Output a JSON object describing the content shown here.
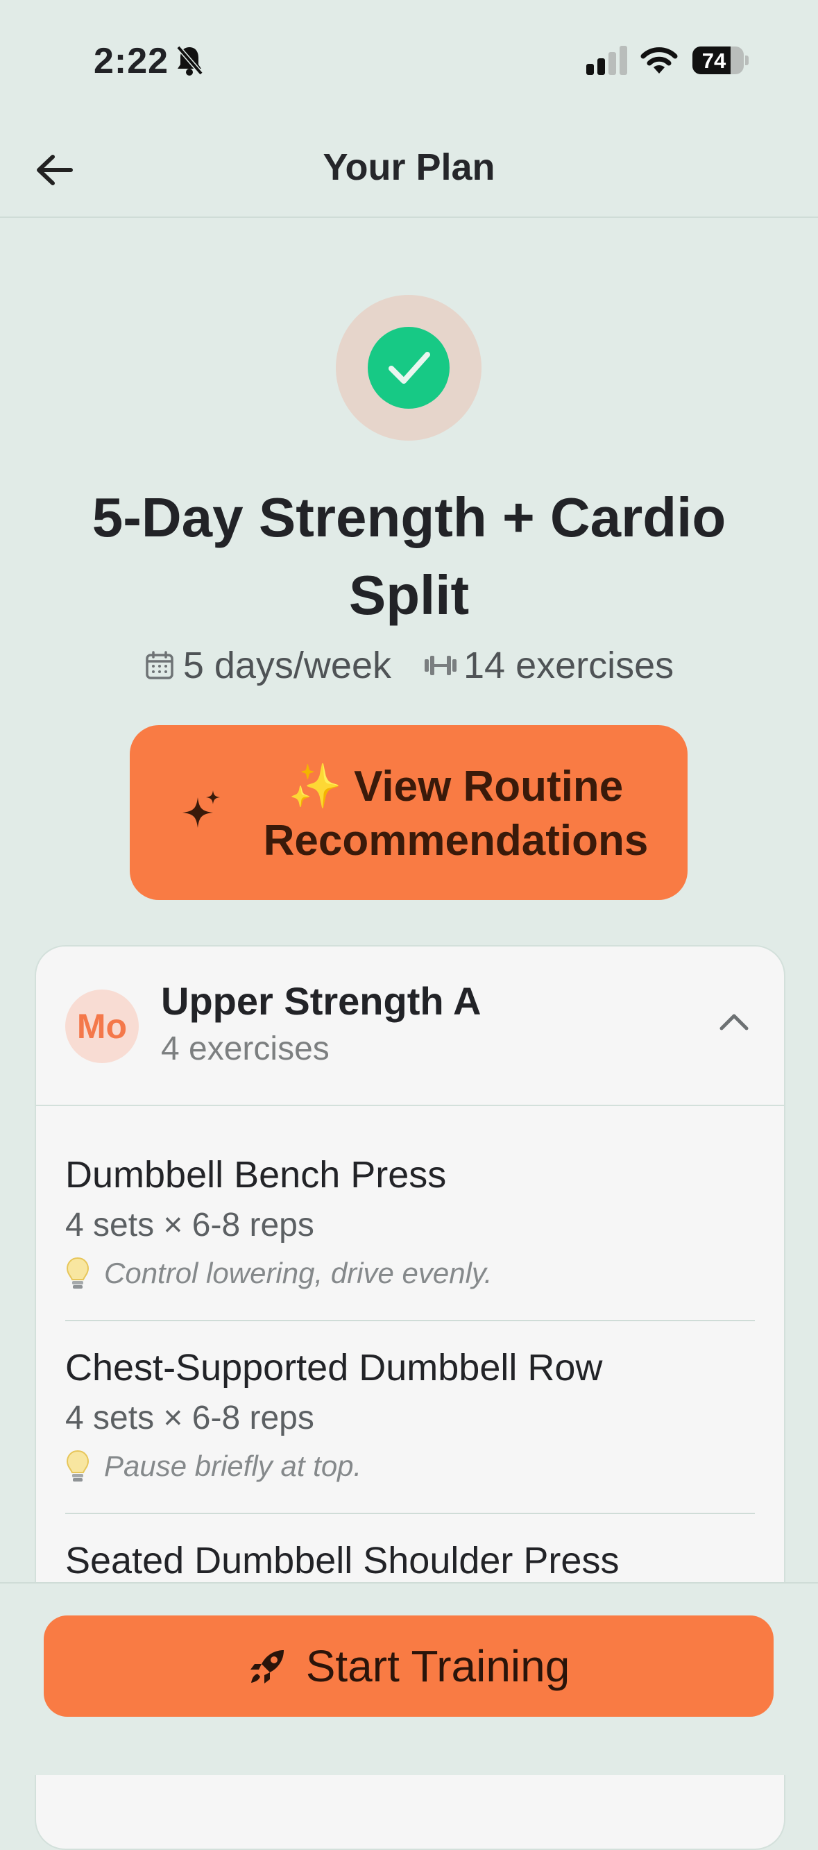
{
  "status_bar": {
    "time": "2:22",
    "battery": "74",
    "battery_level": 0.74
  },
  "header": {
    "title": "Your Plan"
  },
  "plan": {
    "title_line1": "5-Day Strength + Cardio",
    "title_line2": "Split",
    "days": "5 days/week",
    "exercises": "14 exercises"
  },
  "recommend_button": {
    "emoji": "✨",
    "line1": "View Routine",
    "line2": "Recommendations"
  },
  "day_card": {
    "avatar": "Mo",
    "name": "Upper Strength A",
    "count": "4 exercises",
    "exercises": [
      {
        "name": "Dumbbell Bench Press",
        "sets": "4 sets × 6-8 reps",
        "tip": "Control lowering, drive evenly."
      },
      {
        "name": "Chest-Supported Dumbbell Row",
        "sets": "4 sets × 6-8 reps",
        "tip": "Pause briefly at top."
      },
      {
        "name": "Seated Dumbbell Shoulder Press"
      }
    ]
  },
  "start_button": {
    "label": "Start Training"
  },
  "colors": {
    "accent": "#f97b44",
    "success": "#17c985",
    "background": "#e1ebe7"
  }
}
